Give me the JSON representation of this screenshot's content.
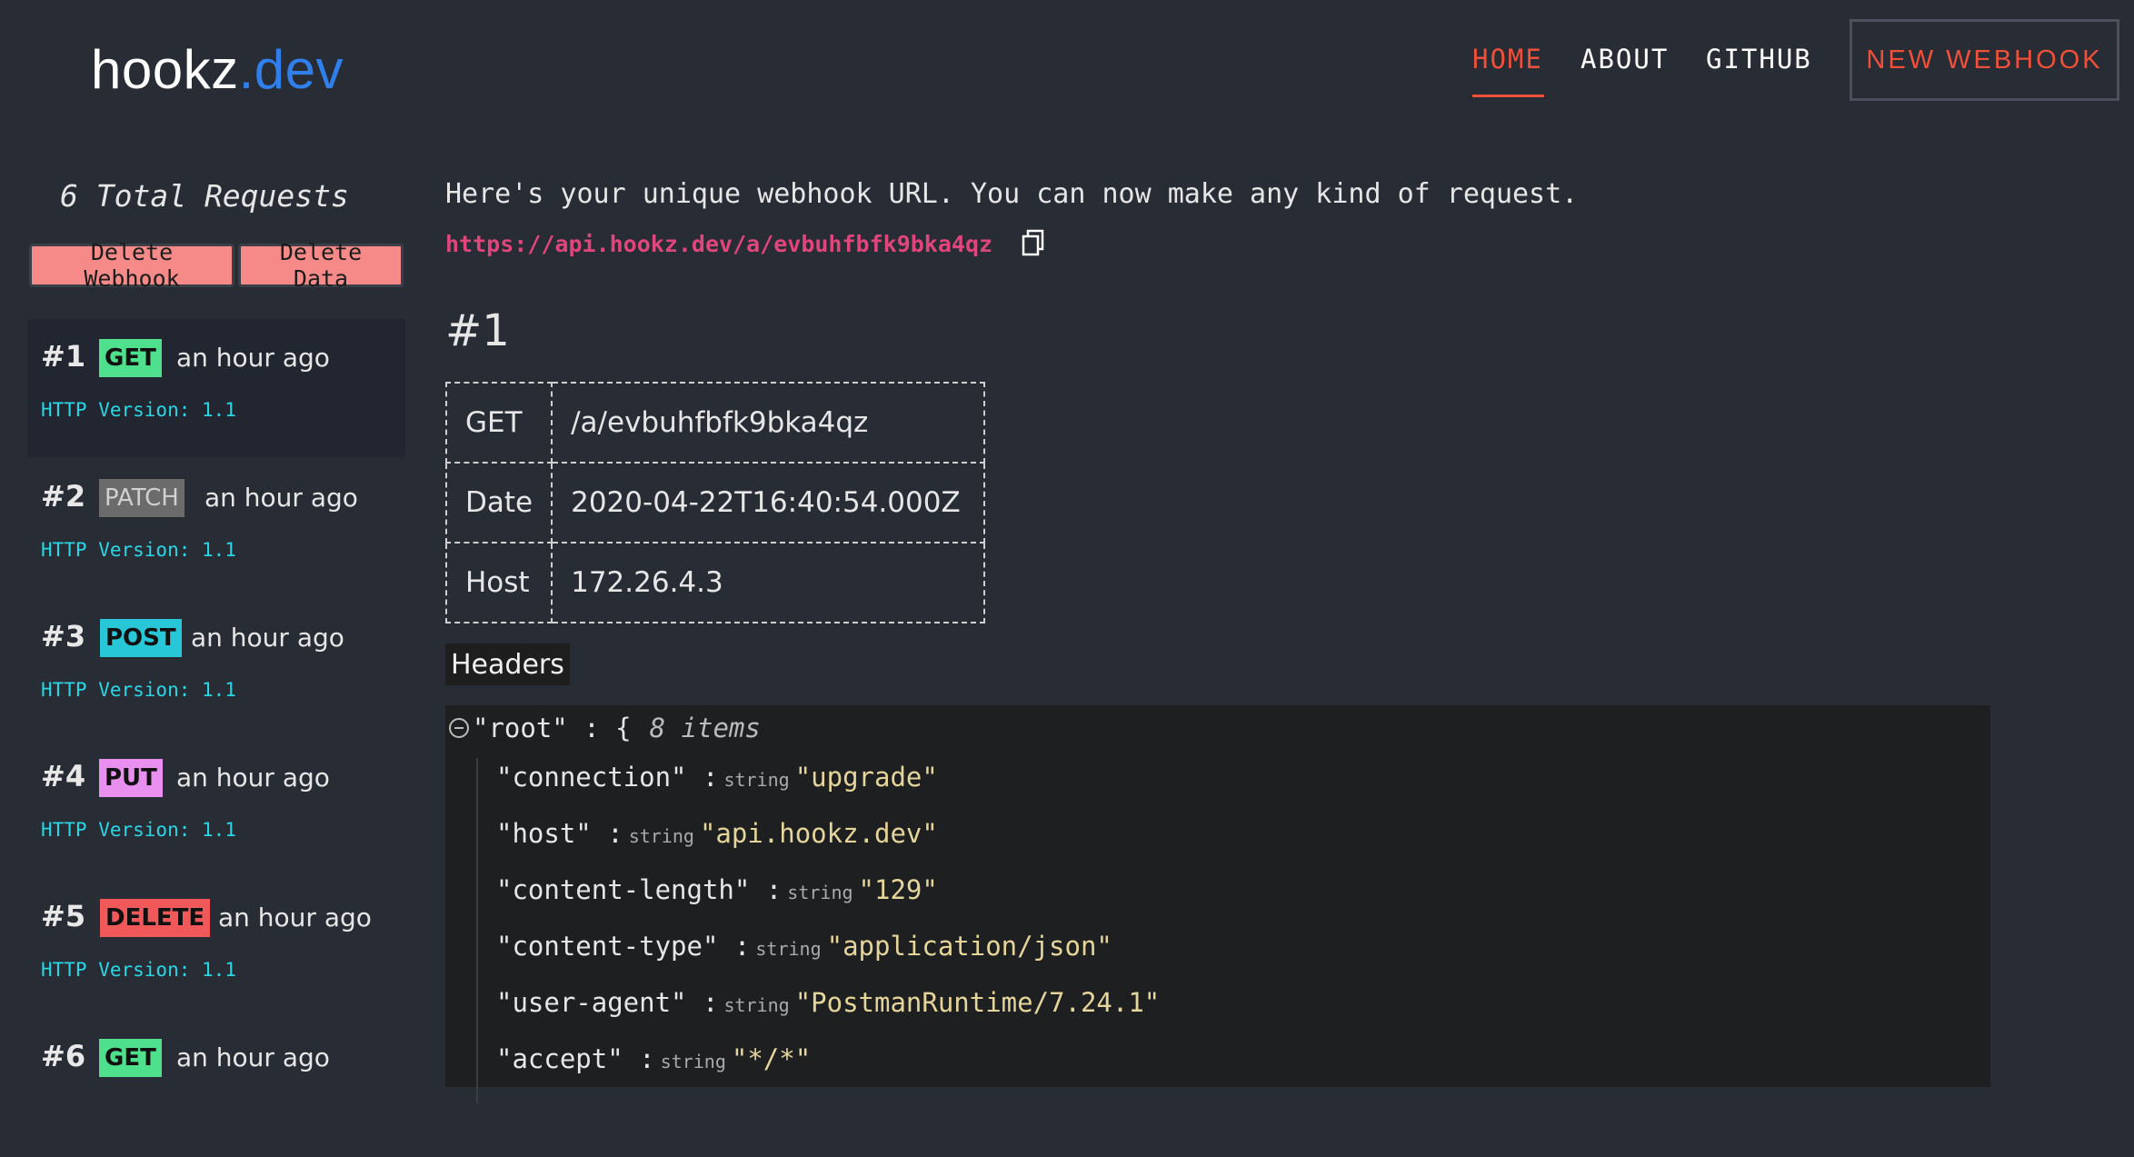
{
  "header": {
    "logo_main": "hookz",
    "logo_accent": ".dev",
    "nav": [
      {
        "label": "HOME",
        "active": true
      },
      {
        "label": "ABOUT",
        "active": false
      },
      {
        "label": "GITHUB",
        "active": false
      }
    ],
    "new_webhook_label": "NEW WEBHOOK"
  },
  "sidebar": {
    "total_requests": "6  Total Requests",
    "delete_webhook_label": "Delete Webhook",
    "delete_data_label": "Delete Data",
    "requests": [
      {
        "num": "#1",
        "method": "GET",
        "time": "an hour ago",
        "version": "HTTP Version: 1.1",
        "color": "#4ee08c"
      },
      {
        "num": "#2",
        "method": "PATCH",
        "time": "an hour ago",
        "version": "HTTP Version: 1.1",
        "color": "#6b6b6b"
      },
      {
        "num": "#3",
        "method": "POST",
        "time": "an hour ago",
        "version": "HTTP Version: 1.1",
        "color": "#28c7d8"
      },
      {
        "num": "#4",
        "method": "PUT",
        "time": "an hour ago",
        "version": "HTTP Version: 1.1",
        "color": "#e88ff0"
      },
      {
        "num": "#5",
        "method": "DELETE",
        "time": "an hour ago",
        "version": "HTTP Version: 1.1",
        "color": "#f0585a"
      },
      {
        "num": "#6",
        "method": "GET",
        "time": "an hour ago",
        "version": "",
        "color": "#4ee08c"
      }
    ]
  },
  "main": {
    "intro": "Here's your unique webhook URL. You can now make any kind of request.",
    "webhook_url": "https://api.hookz.dev/a/evbuhfbfk9bka4qz",
    "request_title": "#1",
    "info": [
      {
        "key": "GET",
        "value": "/a/evbuhfbfk9bka4qz"
      },
      {
        "key": "Date",
        "value": "2020-04-22T16:40:54.000Z"
      },
      {
        "key": "Host",
        "value": "172.26.4.3"
      }
    ],
    "headers_label": "Headers",
    "json": {
      "root_label": "\"root\" : {",
      "count": "8 items",
      "rows": [
        {
          "key": "\"connection\" :",
          "type": "string",
          "value": "\"upgrade\""
        },
        {
          "key": "\"host\" :",
          "type": "string",
          "value": "\"api.hookz.dev\""
        },
        {
          "key": "\"content-length\" :",
          "type": "string",
          "value": "\"129\""
        },
        {
          "key": "\"content-type\" :",
          "type": "string",
          "value": "\"application/json\""
        },
        {
          "key": "\"user-agent\" :",
          "type": "string",
          "value": "\"PostmanRuntime/7.24.1\""
        },
        {
          "key": "\"accept\" :",
          "type": "string",
          "value": "\"*/*\""
        }
      ]
    }
  },
  "icons": {
    "copy": "copy-icon",
    "collapse": "minus-circle-icon"
  }
}
